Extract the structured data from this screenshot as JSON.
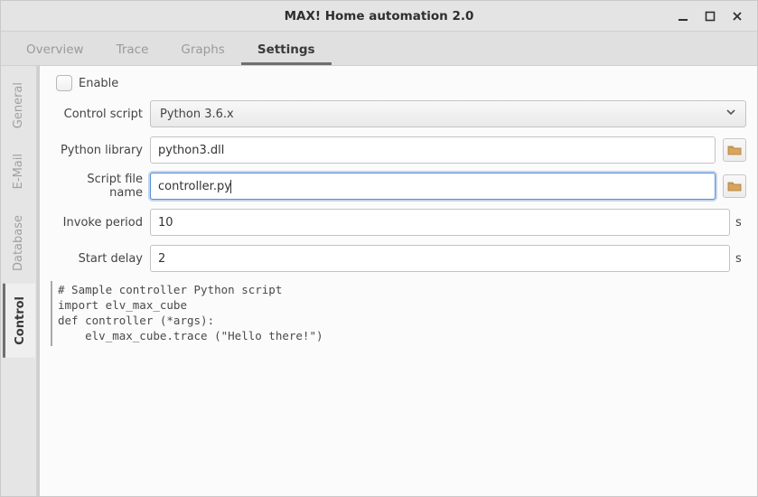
{
  "window": {
    "title": "MAX! Home automation 2.0"
  },
  "top_tabs": {
    "items": [
      "Overview",
      "Trace",
      "Graphs",
      "Settings"
    ],
    "active_index": 3
  },
  "side_tabs": {
    "items": [
      "General",
      "E-Mail",
      "Database",
      "Control"
    ],
    "active_index": 3
  },
  "form": {
    "enable_label": "Enable",
    "enable_checked": false,
    "control_script_label": "Control script",
    "control_script_value": "Python 3.6.x",
    "python_library_label": "Python library",
    "python_library_value": "python3.dll",
    "script_file_label": "Script file name",
    "script_file_value": "controller.py",
    "invoke_period_label": "Invoke period",
    "invoke_period_value": "10",
    "invoke_period_unit": "s",
    "start_delay_label": "Start delay",
    "start_delay_value": "2",
    "start_delay_unit": "s"
  },
  "sample_code": "# Sample controller Python script\nimport elv_max_cube\ndef controller (*args):\n    elv_max_cube.trace (\"Hello there!\")"
}
